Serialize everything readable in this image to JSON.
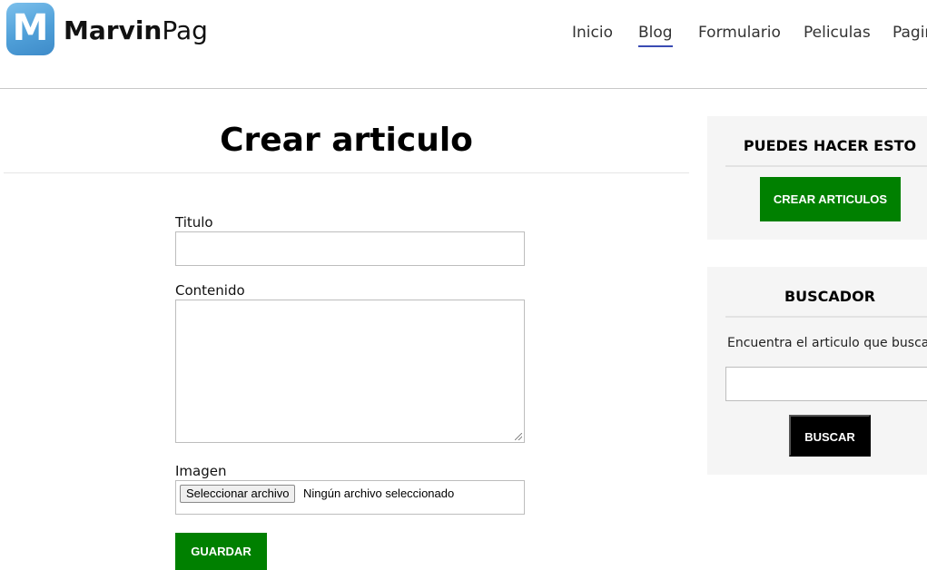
{
  "header": {
    "logo_letter": "M",
    "brand_bold": "Marvin",
    "brand_light": "Pag",
    "nav": [
      {
        "label": "Inicio"
      },
      {
        "label": "Blog"
      },
      {
        "label": "Formulario"
      },
      {
        "label": "Peliculas"
      },
      {
        "label": "Pagin"
      }
    ]
  },
  "main": {
    "title": "Crear articulo",
    "form": {
      "title_label": "Titulo",
      "title_value": "",
      "content_label": "Contenido",
      "content_value": "",
      "image_label": "Imagen",
      "file_button": "Seleccionar archivo",
      "file_status": "Ningún archivo seleccionado",
      "submit_label": "GUARDAR"
    }
  },
  "sidebar": {
    "actions": {
      "title": "PUEDES HACER ESTO",
      "button_label": "CREAR ARTICULOS"
    },
    "search": {
      "title": "BUSCADOR",
      "description": "Encuentra el articulo que buscas",
      "input_value": "",
      "button_label": "BUSCAR"
    }
  },
  "colors": {
    "primary_green": "#008000",
    "nav_active_underline": "#3a4bb3",
    "logo_blue": "#4f9fd8"
  },
  "icons": {
    "logo": "logo-m-icon"
  }
}
